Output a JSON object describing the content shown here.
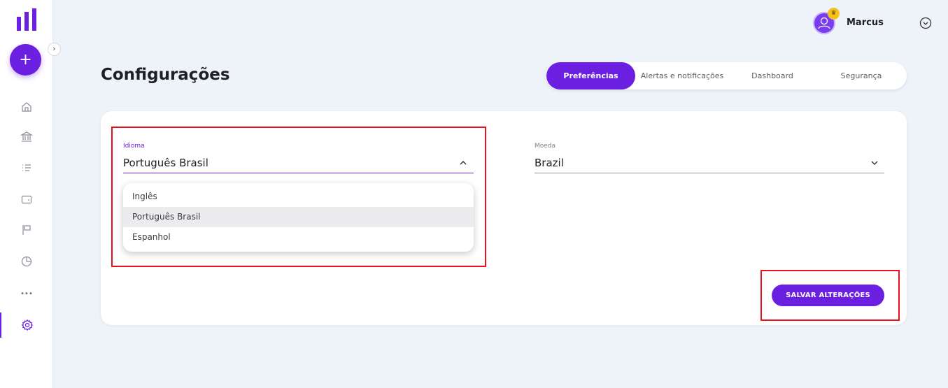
{
  "sidebar": {
    "logo_icon": "bars-logo-icon",
    "add_label": "+",
    "expand_label": "›",
    "items": [
      {
        "icon": "home-icon"
      },
      {
        "icon": "bank-icon"
      },
      {
        "icon": "list-icon"
      },
      {
        "icon": "wallet-icon"
      },
      {
        "icon": "flag-icon"
      },
      {
        "icon": "pie-chart-icon"
      },
      {
        "icon": "more-icon",
        "label": "•••"
      },
      {
        "icon": "gear-icon",
        "active": true
      }
    ]
  },
  "header": {
    "user_name": "Marcus",
    "crown_glyph": "♛",
    "accent_color": "#6b1fe0"
  },
  "page": {
    "title": "Configurações",
    "tabs": [
      {
        "label": "Preferências",
        "active": true
      },
      {
        "label": "Alertas e notificações"
      },
      {
        "label": "Dashboard"
      },
      {
        "label": "Segurança"
      }
    ]
  },
  "form": {
    "language": {
      "label": "Idioma",
      "value": "Português Brasil",
      "options": [
        "Inglês",
        "Português Brasil",
        "Espanhol"
      ],
      "selected_index": 1
    },
    "currency": {
      "label": "Moeda",
      "value": "Brazil"
    },
    "save_label": "SALVAR ALTERAÇÕES"
  }
}
